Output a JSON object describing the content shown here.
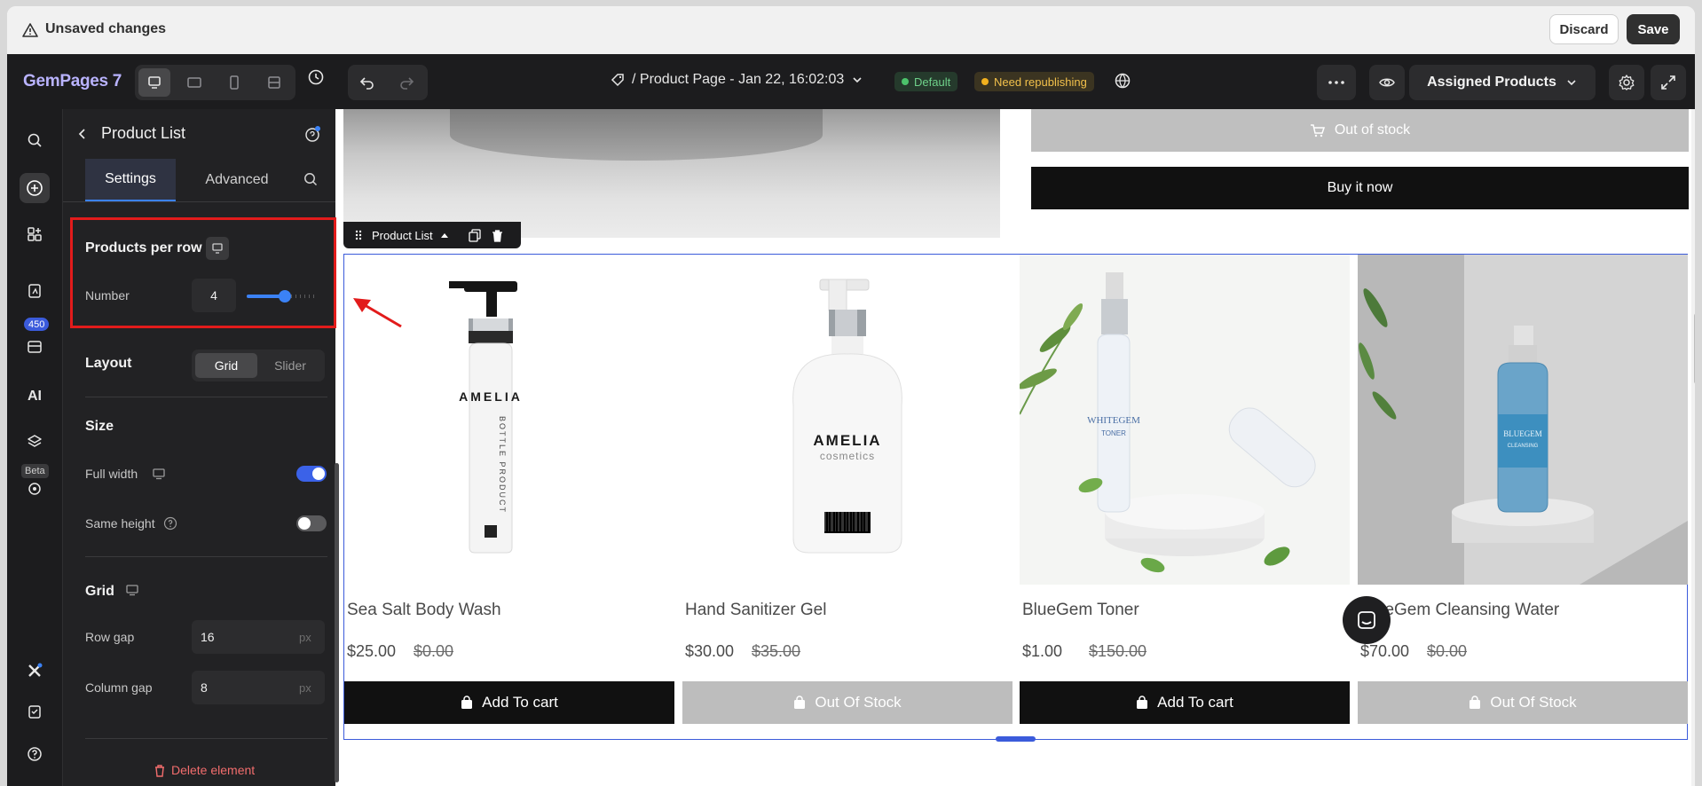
{
  "unsaved_bar": {
    "message": "Unsaved changes",
    "discard_label": "Discard",
    "save_label": "Save"
  },
  "topbar": {
    "logo": "GemPages 7",
    "page_title": "/ Product Page - Jan 22, 16:02:03",
    "badge_default": "Default",
    "badge_republish": "Need republishing",
    "assigned_label": "Assigned Products",
    "colors": {
      "default": "#6fd18a",
      "republish": "#f2c04b"
    }
  },
  "rail": {
    "badge_count": "450",
    "ai_label": "AI",
    "beta_label": "Beta"
  },
  "panel": {
    "title": "Product List",
    "tabs": [
      "Settings",
      "Advanced"
    ],
    "products_per_row": {
      "title": "Products per row",
      "number_label": "Number",
      "value": "4",
      "slider_fraction": 0.55
    },
    "layout": {
      "title": "Layout",
      "options": [
        "Grid",
        "Slider"
      ],
      "selected": "Grid"
    },
    "size": {
      "title": "Size",
      "full_width_label": "Full width",
      "full_width": true,
      "same_height_label": "Same height",
      "same_height": false
    },
    "grid": {
      "title": "Grid",
      "row_gap_label": "Row gap",
      "row_gap": "16",
      "column_gap_label": "Column gap",
      "column_gap": "8",
      "unit": "px"
    },
    "delete_label": "Delete element"
  },
  "canvas": {
    "top_oos_label": "Out of stock",
    "buy_now_label": "Buy it now",
    "product_list_tag": "Product List",
    "products": [
      {
        "name": "Sea Salt Body Wash",
        "price": "$25.00",
        "compare": "$0.00",
        "cta": "Add To cart",
        "in_stock": true
      },
      {
        "name": "Hand Sanitizer Gel",
        "price": "$30.00",
        "compare": "$35.00",
        "cta": "Out Of Stock",
        "in_stock": false
      },
      {
        "name": "BlueGem Toner",
        "price": "$1.00",
        "compare": "$150.00",
        "cta": "Add To cart",
        "in_stock": true
      },
      {
        "name": "BlueGem Cleansing Water",
        "price": "$70.00",
        "compare": "$0.00",
        "cta": "Out Of Stock",
        "in_stock": false
      }
    ],
    "product_labels": {
      "p0_brand": "AMELIA",
      "p0_sub": "BOTTLE PRODUCT",
      "p1_brand": "AMELIA",
      "p1_sub": "cosmetics",
      "p2_brand": "WHITEGEM",
      "p2_sub": "TONER",
      "p3_brand": "BLUEGEM",
      "p3_sub": "CLEANSING"
    }
  }
}
